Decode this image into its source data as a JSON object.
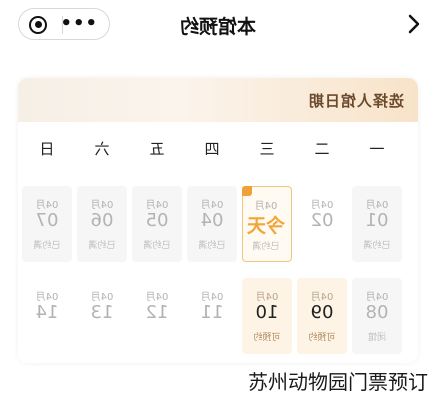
{
  "header": {
    "title": "本馆预约"
  },
  "calendar": {
    "title": "选择人馆日期",
    "weekdays": [
      "一",
      "二",
      "三",
      "四",
      "五",
      "六",
      "日"
    ],
    "week1": [
      {
        "month": "04月",
        "day": "01",
        "status": "已约满",
        "state": "full"
      },
      {
        "month": "04月",
        "day": "02",
        "status": "",
        "state": "plain"
      },
      {
        "month": "04月",
        "day": "今天",
        "status": "已约满",
        "state": "today"
      },
      {
        "month": "04月",
        "day": "04",
        "status": "已约满",
        "state": "full"
      },
      {
        "month": "04月",
        "day": "05",
        "status": "已约满",
        "state": "full"
      },
      {
        "month": "04月",
        "day": "06",
        "status": "已约满",
        "state": "full"
      },
      {
        "month": "04月",
        "day": "07",
        "status": "已约满",
        "state": "full"
      }
    ],
    "week2": [
      {
        "month": "04月",
        "day": "08",
        "status": "闭馆",
        "state": "full"
      },
      {
        "month": "04月",
        "day": "09",
        "status": "可预约",
        "state": "avail"
      },
      {
        "month": "04月",
        "day": "10",
        "status": "可预约",
        "state": "avail"
      },
      {
        "month": "04月",
        "day": "11",
        "status": "",
        "state": "plain"
      },
      {
        "month": "04月",
        "day": "12",
        "status": "",
        "state": "plain"
      },
      {
        "month": "04月",
        "day": "13",
        "status": "",
        "state": "plain"
      },
      {
        "month": "04月",
        "day": "14",
        "status": "",
        "state": "plain"
      }
    ]
  },
  "caption": "苏州动物园门票预订",
  "colors": {
    "accent": "#f2a53b",
    "header_text": "#6b4a2c",
    "available_bg": "#fdf4e6"
  }
}
